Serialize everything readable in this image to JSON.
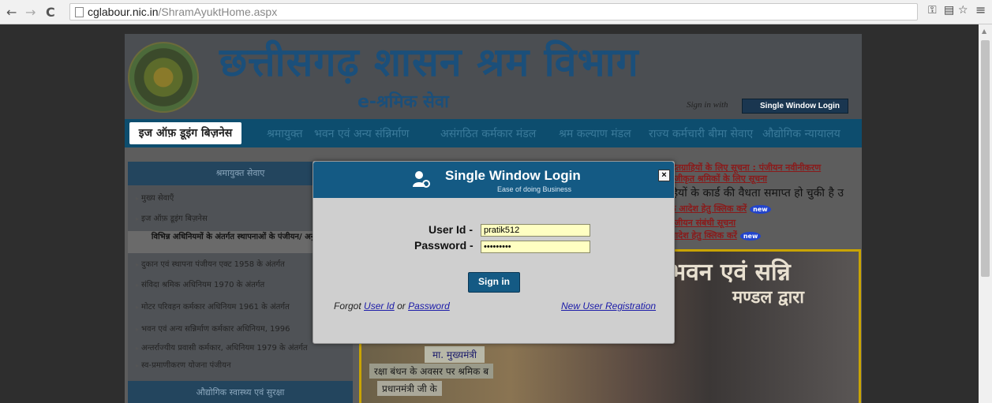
{
  "browser": {
    "back_icon": "←",
    "forward_icon": "→",
    "reload_icon": "C",
    "url_host": "cglabour.nic.in",
    "url_path": "/ShramAyuktHome.aspx",
    "key_icon": "⚿",
    "translate_icon": "▤",
    "star_icon": "☆",
    "menu_icon": "≡"
  },
  "header": {
    "title": "छत्तीसगढ़ शासन श्रम विभाग",
    "subtitle": "e-श्रमिक सेवा",
    "sign_in_with": "Sign in with",
    "swl_button": "Single Window Login",
    "swl_tagline": "Ease of doing Business"
  },
  "nav": {
    "items": [
      "इज ऑफ़ डूइंग बिज़नेस",
      "श्रमायुक्त",
      "भवन एवं अन्य संन्निर्माण",
      "असंगठित कर्मकार मंडल",
      "श्रम कल्याण मंडल",
      "राज्य कर्मचारी बीमा सेवाए",
      "औद्योगिक न्यायालय"
    ]
  },
  "sidebar": {
    "heading": "श्रमायुक्त सेवाए",
    "items": [
      "मुख्य सेवाएँ",
      "इज ऑफ़ डूइंग बिज़नेस",
      "विभिन्न अधिनियमों के अंतर्गत स्थापनाओं के पंजीयन/ अनुज्ञप्ति",
      "दुकान एवं स्थापना पंजीयन एक्ट 1958 के अंतर्गत",
      "संविदा श्रमिक अधिनियम 1970 के अंतर्गत",
      "मोटर परिवहन कर्मकार अधिनियम 1961 के अंतर्गत",
      "भवन एवं अन्य सन्निर्माण कर्मकार अधिनियम, 1996",
      "अन्तर्राज्यीय प्रवासी कर्मकार, अधिनियम 1979 के अंतर्गत",
      "स्व-प्रमाणीकरण योजना पंजीयन"
    ],
    "footer": "औद्योगिक स्वास्थ्य एवं सुरक्षा"
  },
  "news": {
    "line1": "हितग्राहियों के लिए सूचना : पंजीयन नवीनीकरण",
    "line2": "पंजीकृत श्रमिकों के लिए सूचना",
    "line3": "हियों के कार्ड की वैधता समाप्त हो चुकी है उ",
    "line4": "के आदेश हेतु क्लिक करें",
    "line5": "पंजीयन संबंधी सूचना",
    "line6": "आदेश हेतु क्लिक करें",
    "new_badge": "new"
  },
  "photo": {
    "banner": "भवन एवं सन्नि",
    "banner2": "मण्डल द्वारा",
    "caption1": "मा. मुख्यमंत्री",
    "caption2": "रक्षा बंधन के अवसर पर श्रमिक ब",
    "caption3": "प्रधानमंत्री जी के"
  },
  "modal": {
    "title": "Single Window Login",
    "subtitle": "Ease of doing Business",
    "close_icon": "×",
    "userid_label": "User Id -",
    "userid_value": "pratik512",
    "password_label": "Password -",
    "password_value": "•••••••••",
    "signin_label": "Sign in",
    "forgot_prefix": "Forgot",
    "forgot_userid": "User Id",
    "forgot_or": "or",
    "forgot_password": "Password",
    "new_user": "New User Registration"
  }
}
